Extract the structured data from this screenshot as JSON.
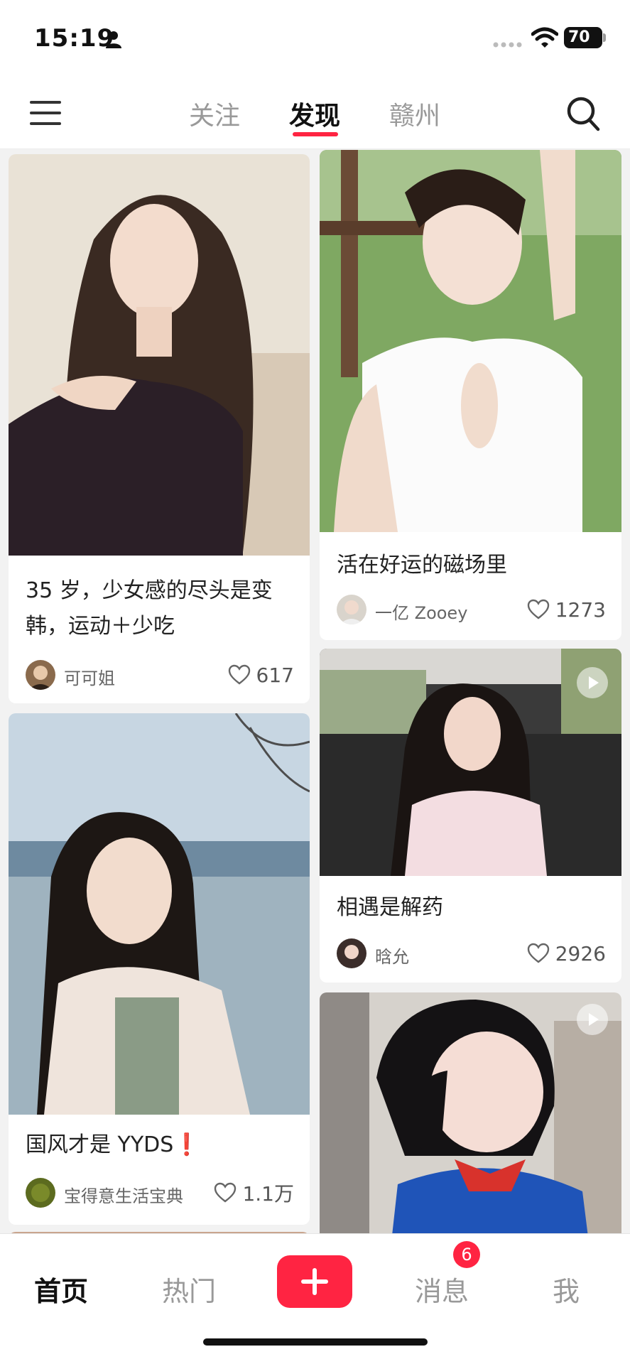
{
  "status_bar": {
    "time": "15:19",
    "battery": "70"
  },
  "header": {
    "tabs": [
      {
        "label": "关注"
      },
      {
        "label": "发现"
      },
      {
        "label": "赣州"
      }
    ]
  },
  "feed": {
    "cards": [
      {
        "title": "35 岁，少女感的尽头是变韩，运动＋少吃",
        "author": "可可姐",
        "likes": "617"
      },
      {
        "title": "活在好运的磁场里",
        "author": "一亿 Zooey",
        "likes": "1273"
      },
      {
        "title": "国风才是 YYDS❗️",
        "author": "宝得意生活宝典",
        "likes": "1.1万"
      },
      {
        "title": "相遇是解药",
        "author": "晗允",
        "likes": "2926"
      },
      {
        "title": "",
        "author": "",
        "likes": ""
      }
    ]
  },
  "bottom_nav": {
    "items": [
      {
        "label": "首页"
      },
      {
        "label": "热门"
      },
      {
        "label": "消息"
      },
      {
        "label": "我"
      }
    ],
    "messages_badge": "6"
  },
  "colors": {
    "accent": "#ff2442"
  }
}
